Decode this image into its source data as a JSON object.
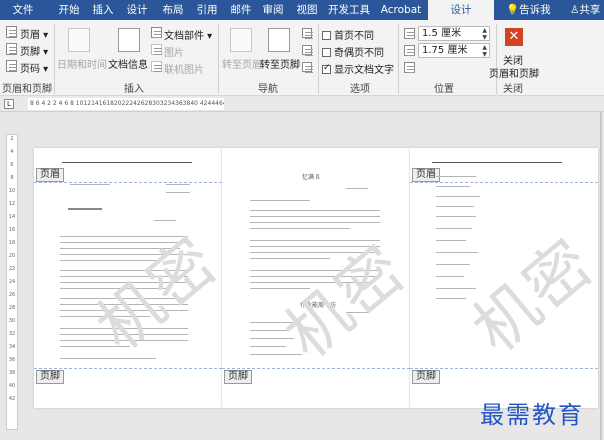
{
  "tabs": [
    "文件",
    "开始",
    "插入",
    "设计",
    "布局",
    "引用",
    "邮件",
    "审阅",
    "视图",
    "开发工具",
    "Acrobat",
    "设计"
  ],
  "tab_search": "告诉我",
  "tab_share": "共享",
  "ribbon": {
    "header_btn": "页眉",
    "footer_btn": "页脚",
    "pagenum_btn": "页码",
    "group1_label": "页眉和页脚",
    "datetime": "日期和时间",
    "docinfo": "文档信息",
    "docparts": "文档部件",
    "picture": "图片",
    "online_picture": "联机图片",
    "group2_label": "插入",
    "goto_header": "转至页眉",
    "goto_footer": "转至页脚",
    "group3_label": "导航",
    "opt_first": "首页不同",
    "opt_oddeven": "奇偶页不同",
    "opt_showtext": "显示文档文字",
    "group4_label": "选项",
    "pos_top": "1.5 厘米",
    "pos_bottom": "1.75 厘米",
    "group5_label": "位置",
    "close_label1": "关闭",
    "close_label2": "页眉和页脚",
    "group6_label": "关闭"
  },
  "ruler_text": "8 6 4 2   2 4 6 8 10121416182022242628303234363840 42444648",
  "vruler_marks": [
    "2",
    "4",
    "6",
    "8",
    "10",
    "12",
    "14",
    "16",
    "18",
    "20",
    "22",
    "24",
    "26",
    "28",
    "30",
    "32",
    "34",
    "36",
    "38",
    "40",
    "42"
  ],
  "pages": [
    {
      "header_tag": "页眉",
      "footer_tag": "页脚",
      "watermark": "机密"
    },
    {
      "header_tag": "",
      "footer_tag": "页脚",
      "watermark": "机密",
      "title": "忆满 ß",
      "subtitle": "作业能周一访"
    },
    {
      "header_tag": "页眉",
      "footer_tag": "页脚",
      "watermark": "机密"
    }
  ],
  "brand": "最需教育"
}
